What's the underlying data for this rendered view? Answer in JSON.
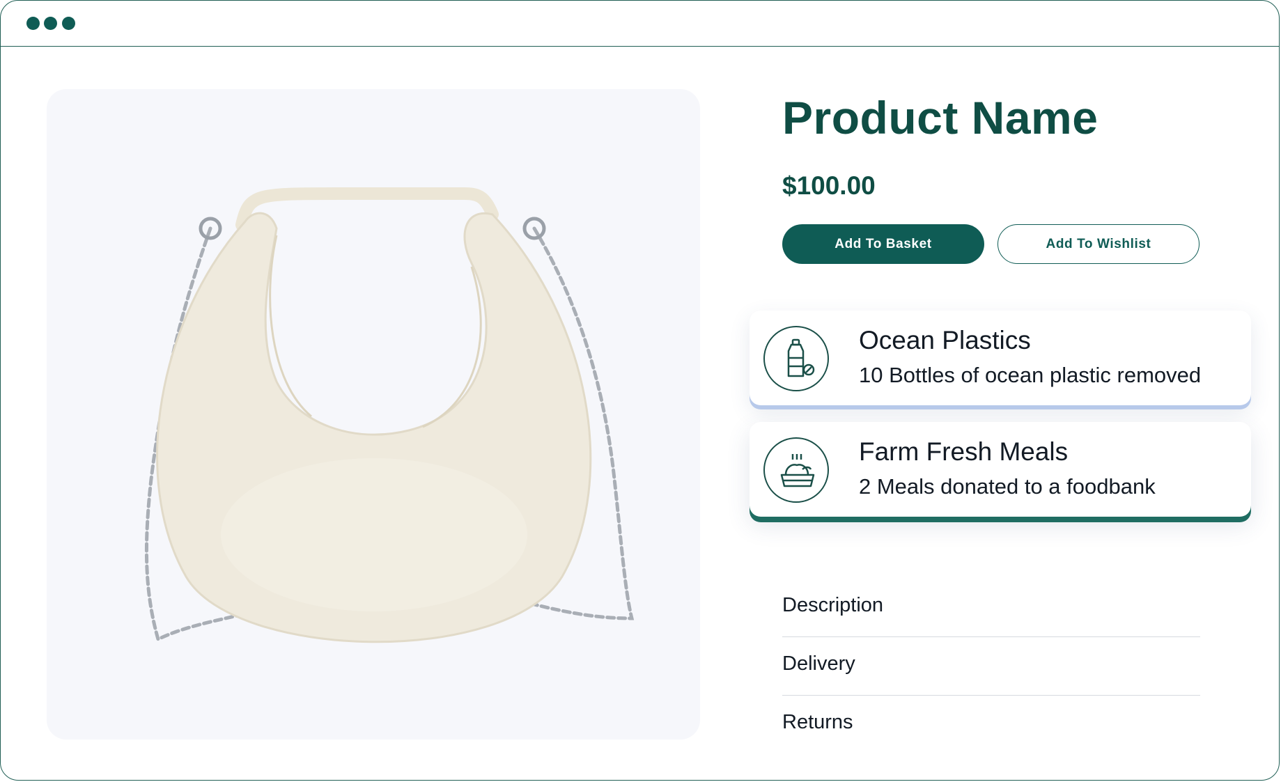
{
  "product": {
    "name": "Product Name",
    "price": "$100.00",
    "image": "white-crescent-shoulder-bag-with-chain"
  },
  "actions": {
    "add_to_basket": "Add To Basket",
    "add_to_wishlist": "Add To Wishlist"
  },
  "impact": [
    {
      "icon": "bottle-icon",
      "title": "Ocean Plastics",
      "text": "10 Bottles of ocean plastic removed"
    },
    {
      "icon": "meal-icon",
      "title": "Farm Fresh Meals",
      "text": "2 Meals donated to a foodbank"
    }
  ],
  "accordion": [
    "Description",
    "Delivery",
    "Returns"
  ],
  "colors": {
    "brand": "#0f5c55",
    "heading": "#0f4d44",
    "image_bg": "#f6f7fb",
    "card1_accent": "#b7c9ea",
    "card2_accent": "#1f6d62"
  }
}
